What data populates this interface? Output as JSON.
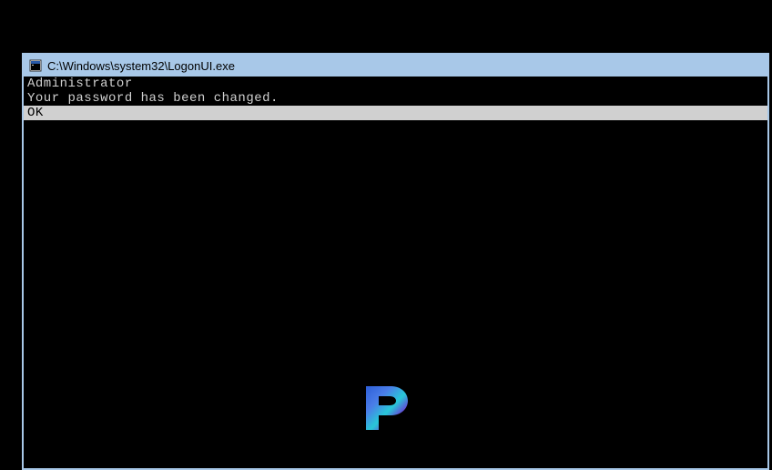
{
  "window": {
    "title": "C:\\Windows\\system32\\LogonUI.exe",
    "icon_name": "console-icon"
  },
  "console": {
    "username": "Administrator",
    "message": "Your password has been changed.",
    "ok_label": "OK"
  },
  "watermark": {
    "letter": "P"
  },
  "colors": {
    "titlebar_bg": "#a8c8e8",
    "console_bg": "#000000",
    "console_fg": "#d0d0d0",
    "selected_bg": "#d0d0d0",
    "selected_fg": "#000000"
  }
}
